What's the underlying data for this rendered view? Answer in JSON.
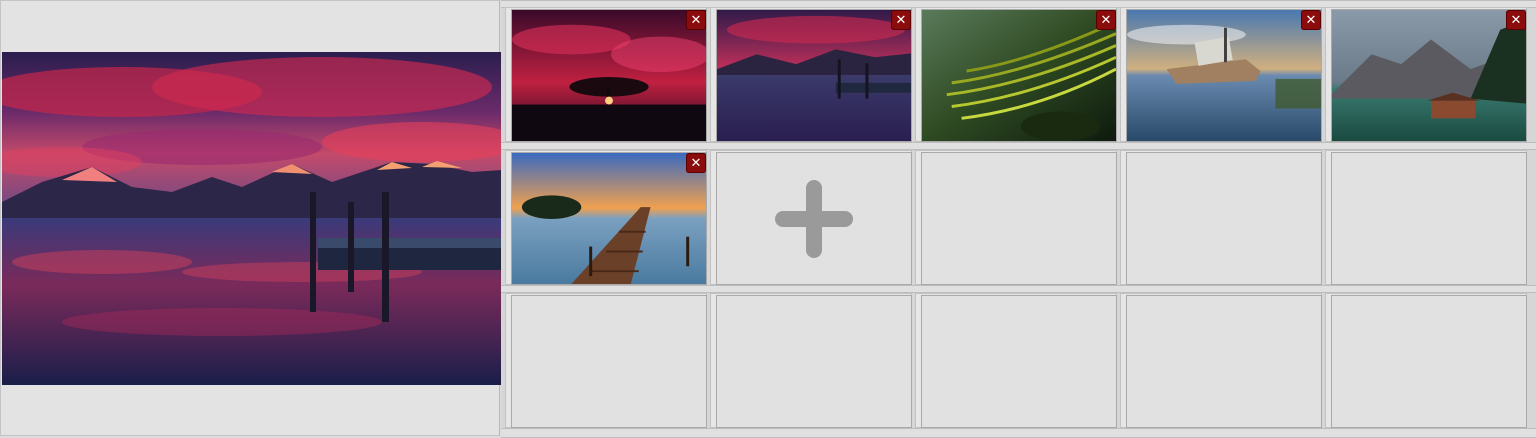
{
  "preview": {
    "image": "lake-sunset-with-pier-and-red-clouds"
  },
  "grid": {
    "rows": 3,
    "columns": 5,
    "images": [
      {
        "image": "red-sky-lone-tree-sunset",
        "remove_label": "✕"
      },
      {
        "image": "lake-dock-red-clouds",
        "remove_label": "✕"
      },
      {
        "image": "green-rice-terraces",
        "remove_label": "✕"
      },
      {
        "image": "shipwreck-in-shallow-water",
        "remove_label": "✕"
      },
      {
        "image": "mountain-lake-boathouse",
        "remove_label": "✕"
      },
      {
        "image": "wooden-pier-at-sunset",
        "remove_label": "✕"
      }
    ],
    "add_icon": "plus-icon"
  },
  "colors": {
    "remove_button": "#8b0c0c",
    "add_icon": "#9a9a9a"
  }
}
